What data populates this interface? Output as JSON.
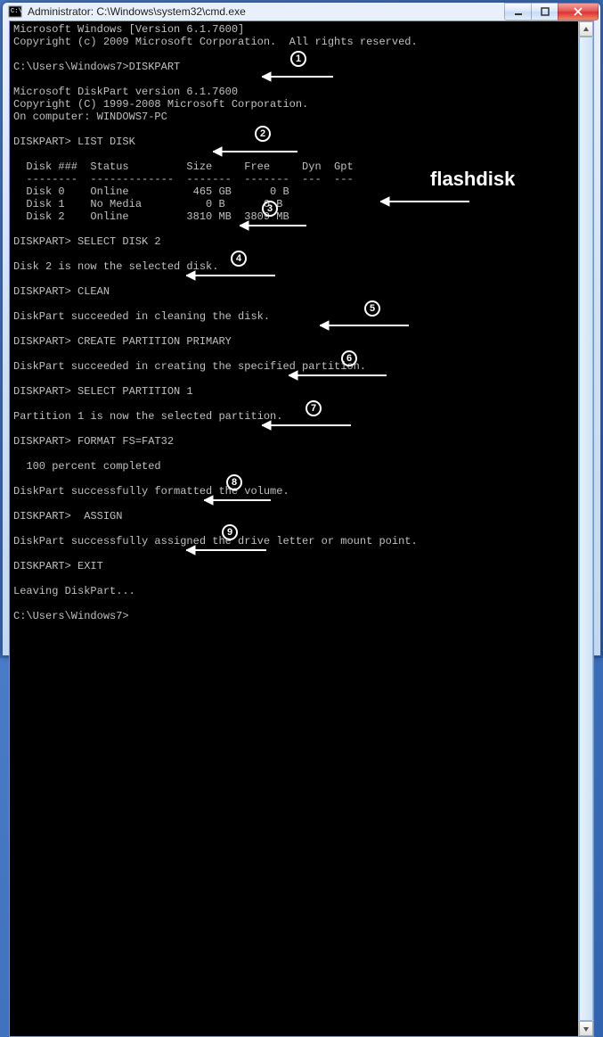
{
  "window": {
    "title": "Administrator: C:\\Windows\\system32\\cmd.exe"
  },
  "terminal": {
    "lines": {
      "l01": "Microsoft Windows [Version 6.1.7600]",
      "l02": "Copyright (c) 2009 Microsoft Corporation.  All rights reserved.",
      "l03": "",
      "l04": "C:\\Users\\Windows7>DISKPART",
      "l05": "",
      "l06": "Microsoft DiskPart version 6.1.7600",
      "l07": "Copyright (C) 1999-2008 Microsoft Corporation.",
      "l08": "On computer: WINDOWS7-PC",
      "l09": "",
      "l10": "DISKPART> LIST DISK",
      "l11": "",
      "l12": "  Disk ###  Status         Size     Free     Dyn  Gpt",
      "l13": "  --------  -------------  -------  -------  ---  ---",
      "l14": "  Disk 0    Online          465 GB      0 B",
      "l15": "  Disk 1    No Media          0 B      0 B",
      "l16": "  Disk 2    Online         3810 MB  3809 MB",
      "l17": "",
      "l18": "DISKPART> SELECT DISK 2",
      "l19": "",
      "l20": "Disk 2 is now the selected disk.",
      "l21": "",
      "l22": "DISKPART> CLEAN",
      "l23": "",
      "l24": "DiskPart succeeded in cleaning the disk.",
      "l25": "",
      "l26": "DISKPART> CREATE PARTITION PRIMARY",
      "l27": "",
      "l28": "DiskPart succeeded in creating the specified partition.",
      "l29": "",
      "l30": "DISKPART> SELECT PARTITION 1",
      "l31": "",
      "l32": "Partition 1 is now the selected partition.",
      "l33": "",
      "l34": "DISKPART> FORMAT FS=FAT32",
      "l35": "",
      "l36": "  100 percent completed",
      "l37": "",
      "l38": "DiskPart successfully formatted the volume.",
      "l39": "",
      "l40": "DISKPART>  ASSIGN",
      "l41": "",
      "l42": "DiskPart successfully assigned the drive letter or mount point.",
      "l43": "",
      "l44": "DISKPART> EXIT",
      "l45": "",
      "l46": "Leaving DiskPart...",
      "l47": "",
      "l48": "C:\\Users\\Windows7>"
    }
  },
  "annotations": {
    "n1": "1",
    "n2": "2",
    "n3": "3",
    "n4": "4",
    "n5": "5",
    "n6": "6",
    "n7": "7",
    "n8": "8",
    "n9": "9",
    "flash": "flashdisk"
  }
}
